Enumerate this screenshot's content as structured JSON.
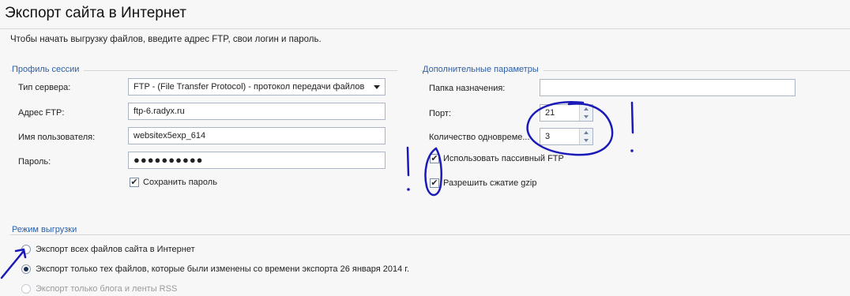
{
  "page": {
    "title": "Экспорт сайта в Интернет",
    "subtitle": "Чтобы начать выгрузку файлов, введите адрес FTP, свои логин и пароль."
  },
  "session": {
    "legend": "Профиль сессии",
    "server_type_label": "Тип сервера:",
    "server_type_value": "FTP - (File Transfer Protocol) - протокол передачи файлов",
    "ftp_label": "Адрес FTP:",
    "ftp_value": "ftp-6.radyx.ru",
    "user_label": "Имя пользователя:",
    "user_value": "websitex5exp_614",
    "password_label": "Пароль:",
    "password_value": "●●●●●●●●●●",
    "save_password_label": "Сохранить пароль",
    "save_password_checked": true
  },
  "advanced": {
    "legend": "Дополнительные параметры",
    "folder_label": "Папка назначения:",
    "folder_value": "",
    "port_label": "Порт:",
    "port_value": "21",
    "connections_label": "Количество одновреме...",
    "connections_value": "3",
    "passive_label": "Использовать пассивный FTP",
    "passive_checked": true,
    "gzip_label": "Разрешить сжатие gzip",
    "gzip_checked": true
  },
  "mode": {
    "legend": "Режим выгрузки",
    "options": [
      {
        "label": "Экспорт всех файлов сайта в Интернет",
        "selected": false,
        "disabled": false
      },
      {
        "label": "Экспорт только тех файлов, которые были изменены со времени экспорта 26 января 2014 г.",
        "selected": true,
        "disabled": false
      },
      {
        "label": "Экспорт только блога и ленты RSS",
        "selected": false,
        "disabled": true
      }
    ]
  },
  "colors": {
    "legend": "#2b5fa8",
    "annotation_ink": "#1a1ab8"
  }
}
